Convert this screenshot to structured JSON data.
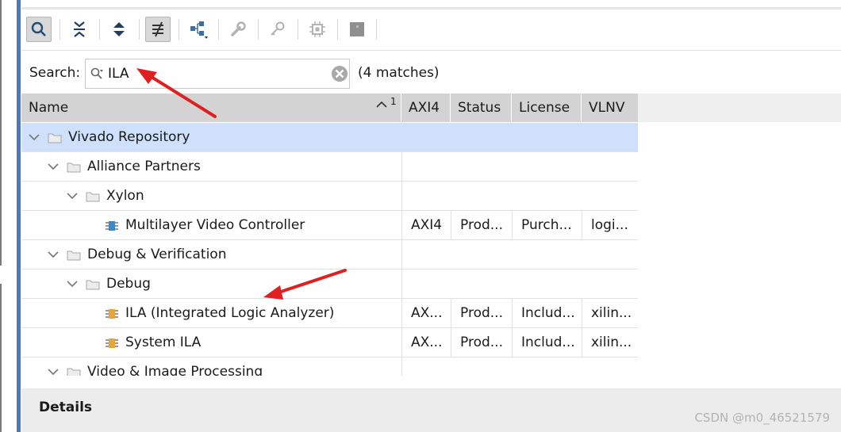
{
  "search": {
    "label": "Search:",
    "value": "ILA",
    "match_count": "(4 matches)"
  },
  "columns": [
    {
      "label": "Name",
      "sort_index": "1"
    },
    {
      "label": "AXI4"
    },
    {
      "label": "Status"
    },
    {
      "label": "License"
    },
    {
      "label": "VLNV"
    }
  ],
  "rows": [
    {
      "name": "Vivado Repository",
      "type": "folder",
      "level": 0,
      "expanded": true,
      "selected": true
    },
    {
      "name": "Alliance Partners",
      "type": "folder",
      "level": 1,
      "expanded": true
    },
    {
      "name": "Xylon",
      "type": "folder",
      "level": 2,
      "expanded": true
    },
    {
      "name": "Multilayer Video Controller",
      "type": "ip",
      "ip_color": "#3b88c9",
      "level": 3,
      "axi4": "AXI4",
      "status": "Prod...",
      "license": "Purch...",
      "vlnv": "logi..."
    },
    {
      "name": "Debug & Verification",
      "type": "folder",
      "level": 1,
      "expanded": true
    },
    {
      "name": "Debug",
      "type": "folder",
      "level": 2,
      "expanded": true
    },
    {
      "name": "ILA (Integrated Logic Analyzer)",
      "type": "ip",
      "ip_color": "#e6a43a",
      "level": 3,
      "axi4": "AX...",
      "status": "Prod...",
      "license": "Includ...",
      "vlnv": "xilin..."
    },
    {
      "name": "System ILA",
      "type": "ip",
      "ip_color": "#e6a43a",
      "level": 3,
      "axi4": "AX...",
      "status": "Prod...",
      "license": "Includ...",
      "vlnv": "xilin..."
    },
    {
      "name": "Video & Image Processing",
      "type": "folder",
      "level": 1,
      "expanded": true
    }
  ],
  "toolbar": {
    "icons": [
      "search-icon",
      "collapse-all-icon",
      "expand-all-icon",
      "filter-icon",
      "hierarchy-icon",
      "wrench-icon",
      "key-icon",
      "chip-icon",
      "unknown-icon"
    ]
  },
  "details": {
    "title": "Details"
  },
  "watermark": "CSDN @m0_46521579",
  "colors": {
    "header_bg": "#d3d3d3",
    "selection": "#cfe0fb",
    "annotation_arrow": "#e02020",
    "accent_bar": "#4a78c2"
  }
}
